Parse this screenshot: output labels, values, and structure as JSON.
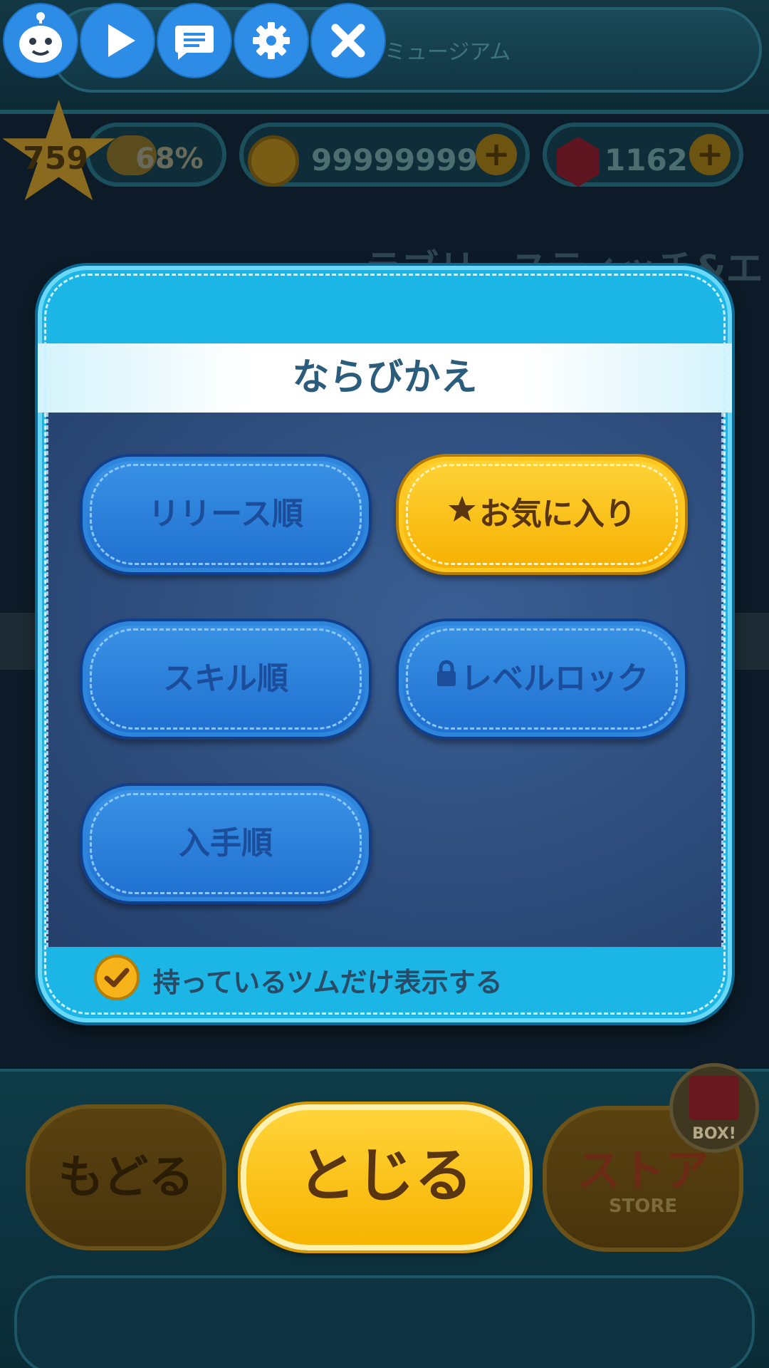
{
  "background": {
    "title_text": "ミュージアム",
    "stats": {
      "level": "759",
      "exp_percent": "68%",
      "coins": "99999999",
      "gems": "1162"
    },
    "tsum_name": "ラブリースティッチ&エンジェル",
    "buttons": {
      "back_label": "もどる",
      "store_label": "ストア",
      "store_sub_label": "STORE",
      "box_label": "BOX!"
    }
  },
  "toolbar": {
    "items": [
      "bot-avatar-icon",
      "play-icon",
      "chat-icon",
      "gear-icon",
      "close-icon"
    ],
    "accent": "#2d8de6"
  },
  "modal": {
    "title": "ならびかえ",
    "options": [
      {
        "label": "リリース順",
        "active": false
      },
      {
        "label": "お気に入り",
        "active": true,
        "icon": "star-icon"
      },
      {
        "label": "スキル順",
        "active": false
      },
      {
        "label": "レベルロック",
        "active": false,
        "icon": "lock-icon"
      },
      {
        "label": "入手順",
        "active": false
      }
    ],
    "filter_label": "持っているツムだけ表示する",
    "filter_checked": true
  },
  "close_button_label": "とじる",
  "colors": {
    "modal_frame": "#1bb5e6",
    "option_blue": "#1f6fcf",
    "option_active": "#f6b000",
    "title_text": "#2b5c7c"
  }
}
